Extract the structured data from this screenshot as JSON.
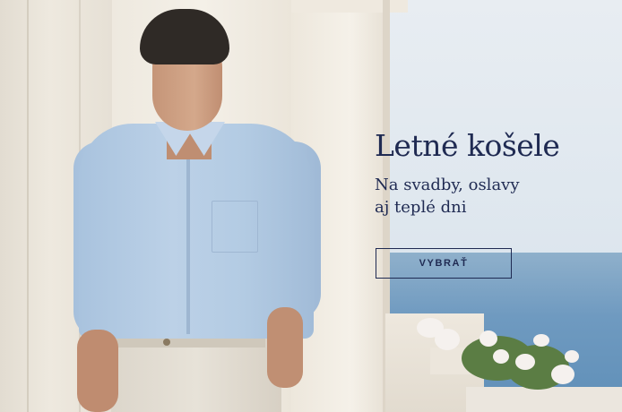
{
  "banner": {
    "title": "Letné košele",
    "subtitle_line1": "Na svadby, oslavy",
    "subtitle_line2": "aj teplé dni",
    "cta_label": "VYBRAŤ"
  },
  "colors": {
    "text": "#1f2a52",
    "sky": "#e4ebf1",
    "sea": "#6f9ac0",
    "stone": "#eee9df",
    "shirt": "#b3cbe3"
  },
  "image": {
    "subject": "man-in-light-blue-linen-shirt"
  }
}
